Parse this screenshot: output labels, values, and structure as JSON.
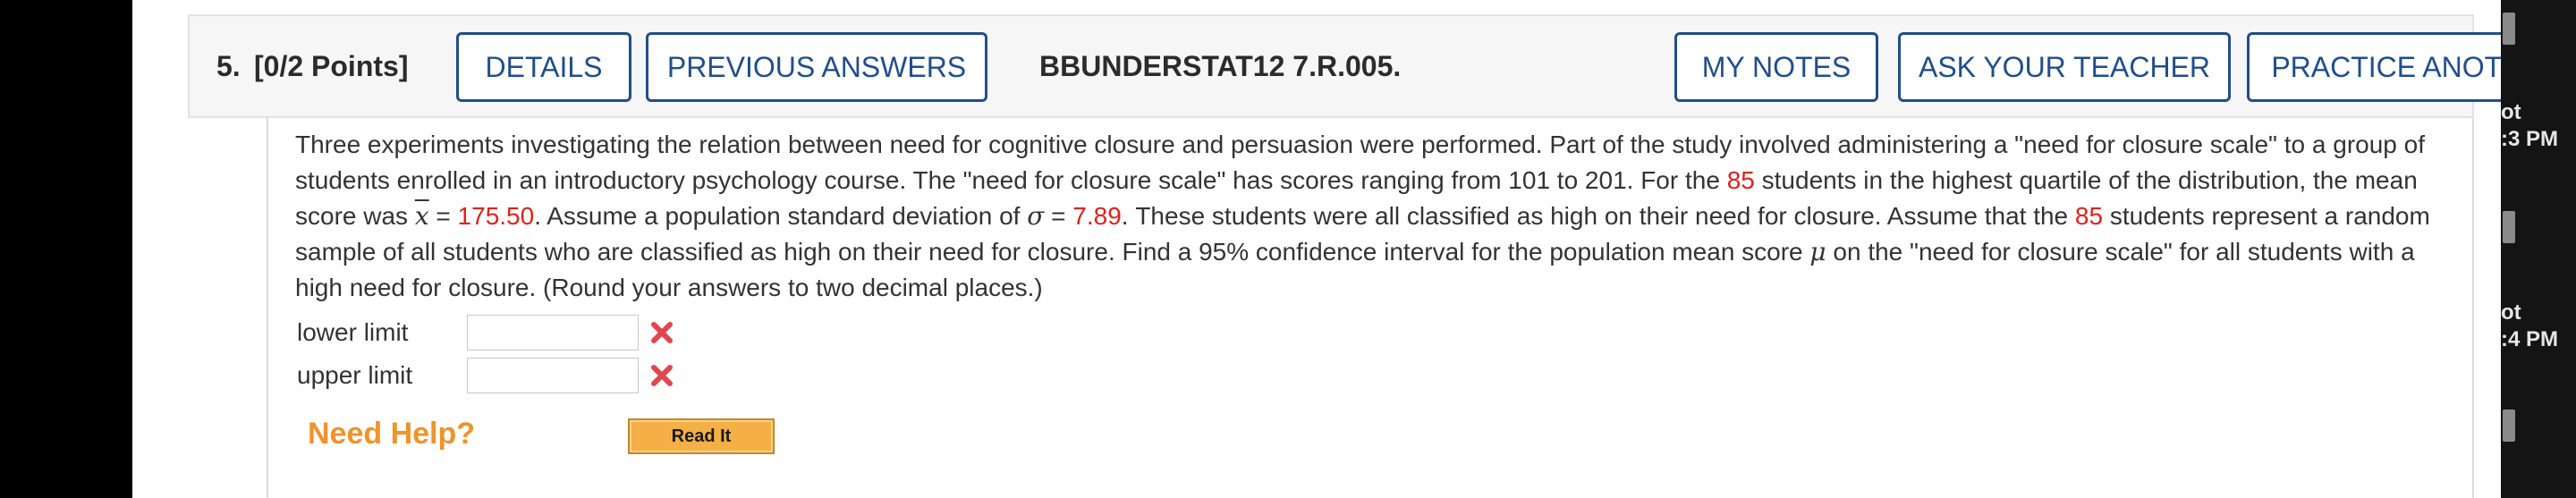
{
  "question": {
    "number": "5.",
    "points": "[0/2 Points]",
    "code": "BBUNDERSTAT12 7.R.005.",
    "buttons": {
      "details": "DETAILS",
      "previous_answers": "PREVIOUS ANSWERS",
      "my_notes": "MY NOTES",
      "ask_teacher": "ASK YOUR TEACHER",
      "practice_another": "PRACTICE ANOTHER"
    },
    "text": {
      "p1": "Three experiments investigating the relation between need for cognitive closure and persuasion were performed. Part of the study involved administering a \"need for closure scale\" to a group of students enrolled in an introductory psychology course. The \"need for closure scale\" has scores ranging from 101 to 201. For the ",
      "n1": "85",
      "p2": " students in the highest quartile of the distribution, the mean score was ",
      "xbar": "x",
      "eq1": " = ",
      "mean": "175.50",
      "p3": ". Assume a population standard deviation of ",
      "sigma": "σ",
      "eq2": " = ",
      "sd": "7.89",
      "p4": ". These students were all classified as high on their need for closure. Assume that the ",
      "n2": "85",
      "p5": " students represent a random sample of all students who are classified as high on their need for closure. Find a 95% confidence interval for the population mean score ",
      "mu": "μ",
      "p6": " on the \"need for closure scale\" for all students with a high need for closure. (Round your answers to two decimal places.)"
    },
    "answers": [
      {
        "label": "lower limit",
        "value": "",
        "status": "incorrect"
      },
      {
        "label": "upper limit",
        "value": "",
        "status": "incorrect"
      }
    ],
    "help": {
      "label": "Need Help?",
      "read_it": "Read It"
    }
  },
  "side": {
    "line1": "ot",
    "line2": ":3 PM",
    "line3": "ot",
    "line4": ":4 PM"
  },
  "colors": {
    "accent": "#1f4e8c",
    "red_value": "#e0211b",
    "help_orange": "#f0932b",
    "incorrect_x": "#e0474c"
  }
}
